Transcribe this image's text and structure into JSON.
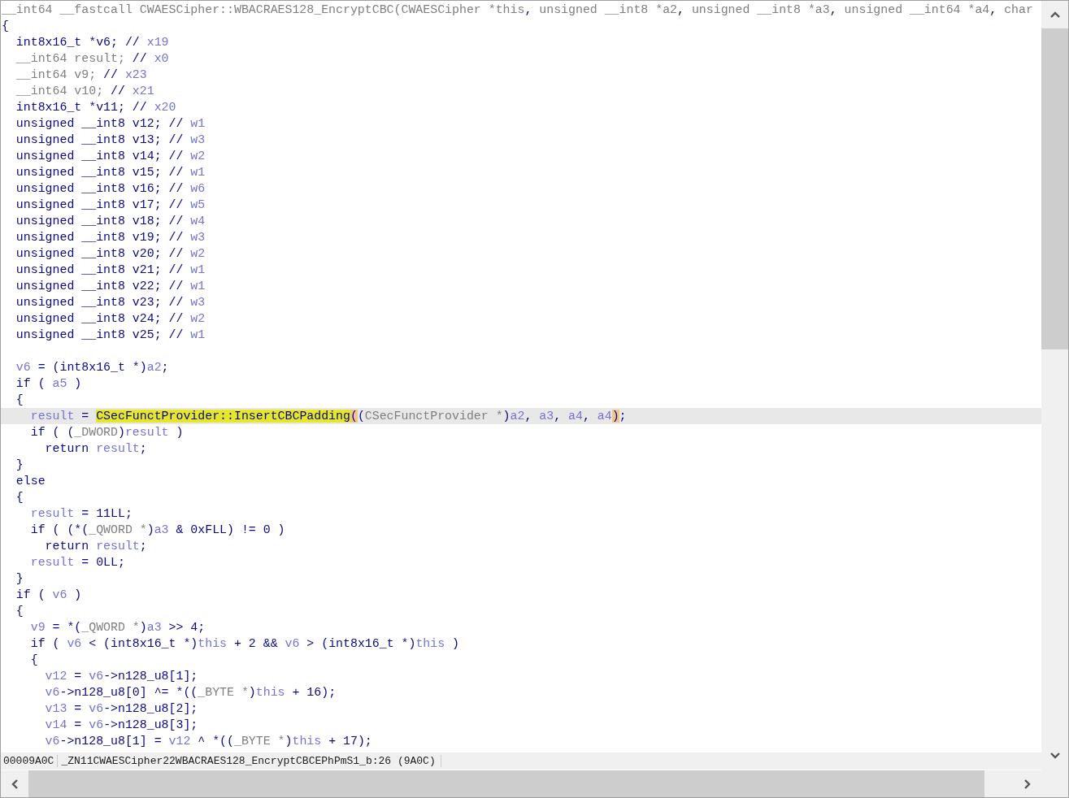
{
  "code": {
    "lines": [
      {
        "current": false,
        "tokens": [
          {
            "kind": "type",
            "text": "__int64 __fastcall CWAESCipher::WBACRAES128_EncryptCBC(CWAESCipher *this"
          },
          {
            "kind": "plain",
            "text": ", "
          },
          {
            "kind": "type",
            "text": "unsigned __int8 *a2"
          },
          {
            "kind": "plain",
            "text": ", "
          },
          {
            "kind": "type",
            "text": "unsigned __int8 *a3"
          },
          {
            "kind": "plain",
            "text": ", "
          },
          {
            "kind": "type",
            "text": "unsigned __int64 *a4"
          },
          {
            "kind": "plain",
            "text": ", "
          },
          {
            "kind": "type",
            "text": "char"
          }
        ]
      },
      {
        "current": false,
        "tokens": [
          {
            "kind": "plain",
            "text": "{"
          }
        ]
      },
      {
        "current": false,
        "tokens": [
          {
            "kind": "plain",
            "text": "  int8x16_t *v6; // "
          },
          {
            "kind": "var",
            "text": "x19"
          }
        ]
      },
      {
        "current": false,
        "tokens": [
          {
            "kind": "type",
            "text": "  __int64 result; "
          },
          {
            "kind": "plain",
            "text": "// "
          },
          {
            "kind": "var",
            "text": "x0"
          }
        ]
      },
      {
        "current": false,
        "tokens": [
          {
            "kind": "type",
            "text": "  __int64 v9; "
          },
          {
            "kind": "plain",
            "text": "// "
          },
          {
            "kind": "var",
            "text": "x23"
          }
        ]
      },
      {
        "current": false,
        "tokens": [
          {
            "kind": "type",
            "text": "  __int64 v10; "
          },
          {
            "kind": "plain",
            "text": "// "
          },
          {
            "kind": "var",
            "text": "x21"
          }
        ]
      },
      {
        "current": false,
        "tokens": [
          {
            "kind": "plain",
            "text": "  int8x16_t *v11; // "
          },
          {
            "kind": "var",
            "text": "x20"
          }
        ]
      },
      {
        "current": false,
        "tokens": [
          {
            "kind": "plain",
            "text": "  unsigned __int8 v12; // "
          },
          {
            "kind": "var",
            "text": "w1"
          }
        ]
      },
      {
        "current": false,
        "tokens": [
          {
            "kind": "plain",
            "text": "  unsigned __int8 v13; // "
          },
          {
            "kind": "var",
            "text": "w3"
          }
        ]
      },
      {
        "current": false,
        "tokens": [
          {
            "kind": "plain",
            "text": "  unsigned __int8 v14; // "
          },
          {
            "kind": "var",
            "text": "w2"
          }
        ]
      },
      {
        "current": false,
        "tokens": [
          {
            "kind": "plain",
            "text": "  unsigned __int8 v15; // "
          },
          {
            "kind": "var",
            "text": "w1"
          }
        ]
      },
      {
        "current": false,
        "tokens": [
          {
            "kind": "plain",
            "text": "  unsigned __int8 v16; // "
          },
          {
            "kind": "var",
            "text": "w6"
          }
        ]
      },
      {
        "current": false,
        "tokens": [
          {
            "kind": "plain",
            "text": "  unsigned __int8 v17; // "
          },
          {
            "kind": "var",
            "text": "w5"
          }
        ]
      },
      {
        "current": false,
        "tokens": [
          {
            "kind": "plain",
            "text": "  unsigned __int8 v18; // "
          },
          {
            "kind": "var",
            "text": "w4"
          }
        ]
      },
      {
        "current": false,
        "tokens": [
          {
            "kind": "plain",
            "text": "  unsigned __int8 v19; // "
          },
          {
            "kind": "var",
            "text": "w3"
          }
        ]
      },
      {
        "current": false,
        "tokens": [
          {
            "kind": "plain",
            "text": "  unsigned __int8 v20; // "
          },
          {
            "kind": "var",
            "text": "w2"
          }
        ]
      },
      {
        "current": false,
        "tokens": [
          {
            "kind": "plain",
            "text": "  unsigned __int8 v21; // "
          },
          {
            "kind": "var",
            "text": "w1"
          }
        ]
      },
      {
        "current": false,
        "tokens": [
          {
            "kind": "plain",
            "text": "  unsigned __int8 v22; // "
          },
          {
            "kind": "var",
            "text": "w1"
          }
        ]
      },
      {
        "current": false,
        "tokens": [
          {
            "kind": "plain",
            "text": "  unsigned __int8 v23; // "
          },
          {
            "kind": "var",
            "text": "w3"
          }
        ]
      },
      {
        "current": false,
        "tokens": [
          {
            "kind": "plain",
            "text": "  unsigned __int8 v24; // "
          },
          {
            "kind": "var",
            "text": "w2"
          }
        ]
      },
      {
        "current": false,
        "tokens": [
          {
            "kind": "plain",
            "text": "  unsigned __int8 v25; // "
          },
          {
            "kind": "var",
            "text": "w1"
          }
        ]
      },
      {
        "current": false
      },
      {
        "current": false,
        "tokens": [
          {
            "kind": "var",
            "text": "  v6"
          },
          {
            "kind": "plain",
            "text": " = (int8x16_t *)"
          },
          {
            "kind": "var",
            "text": "a2"
          },
          {
            "kind": "plain",
            "text": ";"
          }
        ]
      },
      {
        "current": false,
        "tokens": [
          {
            "kind": "plain",
            "text": "  if ( "
          },
          {
            "kind": "var",
            "text": "a5"
          },
          {
            "kind": "plain",
            "text": " )"
          }
        ]
      },
      {
        "current": false,
        "tokens": [
          {
            "kind": "plain",
            "text": "  {"
          }
        ]
      },
      {
        "current": true,
        "tokens": [
          {
            "kind": "var",
            "text": "    result"
          },
          {
            "kind": "plain",
            "text": " = "
          },
          {
            "kind": "hilite",
            "text": "CSecFunctProvider::InsertCBCPadding"
          },
          {
            "kind": "brace",
            "text": "("
          },
          {
            "kind": "plain",
            "text": "("
          },
          {
            "kind": "type",
            "text": "CSecFunctProvider *"
          },
          {
            "kind": "plain",
            "text": ")"
          },
          {
            "kind": "var",
            "text": "a2"
          },
          {
            "kind": "plain",
            "text": ", "
          },
          {
            "kind": "var",
            "text": "a3"
          },
          {
            "kind": "plain",
            "text": ", "
          },
          {
            "kind": "var",
            "text": "a4"
          },
          {
            "kind": "plain",
            "text": ", "
          },
          {
            "kind": "var",
            "text": "a4"
          },
          {
            "kind": "brace",
            "text": ")"
          },
          {
            "kind": "plain",
            "text": ";"
          }
        ]
      },
      {
        "current": false,
        "tokens": [
          {
            "kind": "plain",
            "text": "    if ( ("
          },
          {
            "kind": "type",
            "text": "_DWORD"
          },
          {
            "kind": "plain",
            "text": ")"
          },
          {
            "kind": "var",
            "text": "result"
          },
          {
            "kind": "plain",
            "text": " )"
          }
        ]
      },
      {
        "current": false,
        "tokens": [
          {
            "kind": "plain",
            "text": "      return "
          },
          {
            "kind": "var",
            "text": "result"
          },
          {
            "kind": "plain",
            "text": ";"
          }
        ]
      },
      {
        "current": false,
        "tokens": [
          {
            "kind": "plain",
            "text": "  }"
          }
        ]
      },
      {
        "current": false,
        "tokens": [
          {
            "kind": "plain",
            "text": "  else"
          }
        ]
      },
      {
        "current": false,
        "tokens": [
          {
            "kind": "plain",
            "text": "  {"
          }
        ]
      },
      {
        "current": false,
        "tokens": [
          {
            "kind": "var",
            "text": "    result"
          },
          {
            "kind": "plain",
            "text": " = 11LL;"
          }
        ]
      },
      {
        "current": false,
        "tokens": [
          {
            "kind": "plain",
            "text": "    if ( (*("
          },
          {
            "kind": "type",
            "text": "_QWORD *"
          },
          {
            "kind": "plain",
            "text": ")"
          },
          {
            "kind": "var",
            "text": "a3"
          },
          {
            "kind": "plain",
            "text": " & 0xFLL) != 0 )"
          }
        ]
      },
      {
        "current": false,
        "tokens": [
          {
            "kind": "plain",
            "text": "      return "
          },
          {
            "kind": "var",
            "text": "result"
          },
          {
            "kind": "plain",
            "text": ";"
          }
        ]
      },
      {
        "current": false,
        "tokens": [
          {
            "kind": "var",
            "text": "    result"
          },
          {
            "kind": "plain",
            "text": " = 0LL;"
          }
        ]
      },
      {
        "current": false,
        "tokens": [
          {
            "kind": "plain",
            "text": "  }"
          }
        ]
      },
      {
        "current": false,
        "tokens": [
          {
            "kind": "plain",
            "text": "  if ( "
          },
          {
            "kind": "var",
            "text": "v6"
          },
          {
            "kind": "plain",
            "text": " )"
          }
        ]
      },
      {
        "current": false,
        "tokens": [
          {
            "kind": "plain",
            "text": "  {"
          }
        ]
      },
      {
        "current": false,
        "tokens": [
          {
            "kind": "var",
            "text": "    v9"
          },
          {
            "kind": "plain",
            "text": " = *("
          },
          {
            "kind": "type",
            "text": "_QWORD *"
          },
          {
            "kind": "plain",
            "text": ")"
          },
          {
            "kind": "var",
            "text": "a3"
          },
          {
            "kind": "plain",
            "text": " >> 4;"
          }
        ]
      },
      {
        "current": false,
        "tokens": [
          {
            "kind": "plain",
            "text": "    if ( "
          },
          {
            "kind": "var",
            "text": "v6"
          },
          {
            "kind": "plain",
            "text": " < (int8x16_t *)"
          },
          {
            "kind": "var",
            "text": "this"
          },
          {
            "kind": "plain",
            "text": " + 2 && "
          },
          {
            "kind": "var",
            "text": "v6"
          },
          {
            "kind": "plain",
            "text": " > (int8x16_t *)"
          },
          {
            "kind": "var",
            "text": "this"
          },
          {
            "kind": "plain",
            "text": " )"
          }
        ]
      },
      {
        "current": false,
        "tokens": [
          {
            "kind": "plain",
            "text": "    {"
          }
        ]
      },
      {
        "current": false,
        "tokens": [
          {
            "kind": "var",
            "text": "      v12"
          },
          {
            "kind": "plain",
            "text": " = "
          },
          {
            "kind": "var",
            "text": "v6"
          },
          {
            "kind": "plain",
            "text": "->n128_u8[1];"
          }
        ]
      },
      {
        "current": false,
        "tokens": [
          {
            "kind": "var",
            "text": "      v6"
          },
          {
            "kind": "plain",
            "text": "->n128_u8[0] ^= *(("
          },
          {
            "kind": "type",
            "text": "_BYTE *"
          },
          {
            "kind": "plain",
            "text": ")"
          },
          {
            "kind": "var",
            "text": "this"
          },
          {
            "kind": "plain",
            "text": " + 16);"
          }
        ]
      },
      {
        "current": false,
        "tokens": [
          {
            "kind": "var",
            "text": "      v13"
          },
          {
            "kind": "plain",
            "text": " = "
          },
          {
            "kind": "var",
            "text": "v6"
          },
          {
            "kind": "plain",
            "text": "->n128_u8[2];"
          }
        ]
      },
      {
        "current": false,
        "tokens": [
          {
            "kind": "var",
            "text": "      v14"
          },
          {
            "kind": "plain",
            "text": " = "
          },
          {
            "kind": "var",
            "text": "v6"
          },
          {
            "kind": "plain",
            "text": "->n128_u8[3];"
          }
        ]
      },
      {
        "current": false,
        "tokens": [
          {
            "kind": "var",
            "text": "      v6"
          },
          {
            "kind": "plain",
            "text": "->n128_u8[1] = "
          },
          {
            "kind": "var",
            "text": "v12"
          },
          {
            "kind": "plain",
            "text": " ^ *(("
          },
          {
            "kind": "type",
            "text": "_BYTE *"
          },
          {
            "kind": "plain",
            "text": ")"
          },
          {
            "kind": "var",
            "text": "this"
          },
          {
            "kind": "plain",
            "text": " + 17);"
          }
        ]
      }
    ]
  },
  "status_bar": {
    "address": "00009A0C",
    "location": "_ZN11CWAESCipher22WBACRAES128_EncryptCBCEPhPmS1_b:26 (9A0C)"
  }
}
